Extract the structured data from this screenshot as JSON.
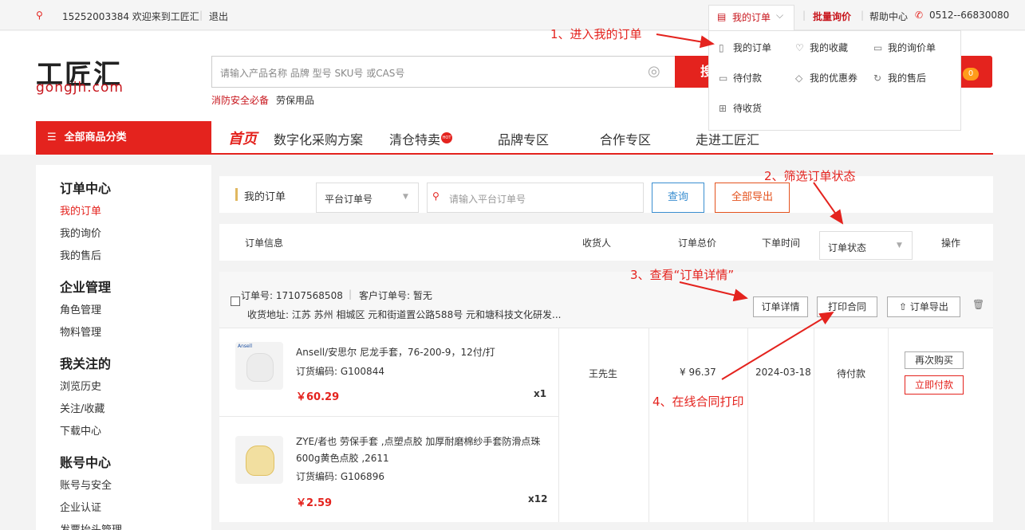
{
  "topbar": {
    "phone_user": "15252003384 欢迎来到工匠汇",
    "logout": "退出",
    "my_orders": "我的订单",
    "batch_inquiry": "批量询价",
    "help": "帮助中心",
    "hotline": "0512--66830080"
  },
  "dropdown": {
    "items": [
      "我的订单",
      "我的收藏",
      "我的询价单",
      "待付款",
      "我的优惠券",
      "我的售后",
      "待收货"
    ]
  },
  "logo": {
    "cn": "工匠汇",
    "en": "gongjh.com"
  },
  "search": {
    "placeholder": "请输入产品名称 品牌 型号 SKU号 或CAS号",
    "button": "搜",
    "hot": [
      "消防安全必备",
      "劳保用品"
    ],
    "cart_count": "0"
  },
  "nav": {
    "all_categories": "全部商品分类",
    "items": [
      "首页",
      "数字化采购方案",
      "清仓特卖",
      "品牌专区",
      "合作专区",
      "走进工匠汇"
    ],
    "hot_badge": "HOT"
  },
  "sidebar": {
    "groups": [
      {
        "title": "订单中心",
        "items": [
          "我的订单",
          "我的询价",
          "我的售后"
        ]
      },
      {
        "title": "企业管理",
        "items": [
          "角色管理",
          "物料管理"
        ]
      },
      {
        "title": "我关注的",
        "items": [
          "浏览历史",
          "关注/收藏",
          "下载中心"
        ]
      },
      {
        "title": "账号中心",
        "items": [
          "账号与安全",
          "企业认证",
          "发票抬头管理"
        ]
      }
    ]
  },
  "filter": {
    "title": "我的订单",
    "select": "平台订单号",
    "placeholder": "请输入平台订单号",
    "query": "查询",
    "export_all": "全部导出"
  },
  "table_head": {
    "info": "订单信息",
    "receiver": "收货人",
    "total": "订单总价",
    "time": "下单时间",
    "status_select": "订单状态",
    "ops": "操作"
  },
  "order": {
    "order_no": "订单号: 17107568508",
    "client_no": "客户订单号: 暂无",
    "address": "收货地址:  江苏 苏州 相城区 元和街道置公路588号 元和塘科技文化研发...",
    "detail_btn": "订单详情",
    "print_btn": "打印合同",
    "export_btn": "订单导出",
    "receiver": "王先生",
    "total": "¥ 96.37",
    "date": "2024-03-18",
    "status": "待付款",
    "rebuy": "再次购买",
    "pay_now": "立即付款",
    "items": [
      {
        "brand_img": "Ansell",
        "name": "Ansell/安思尔 尼龙手套，76-200-9，12付/打",
        "sku": "订货编码:  G100844",
        "price": "￥60.29",
        "qty": "x1"
      },
      {
        "brand_img": "",
        "name": "ZYE/者也 劳保手套 ,点塑点胶 加厚耐磨棉纱手套防滑点珠",
        "name2": "600g黄色点胶 ,2611",
        "sku": "订货编码:  G106896",
        "price": "￥2.59",
        "qty": "x12"
      }
    ]
  },
  "annotations": {
    "a1": "1、进入我的订单",
    "a2": "2、筛选订单状态",
    "a3": "3、查看“订单详情”",
    "a4": "4、在线合同打印"
  }
}
